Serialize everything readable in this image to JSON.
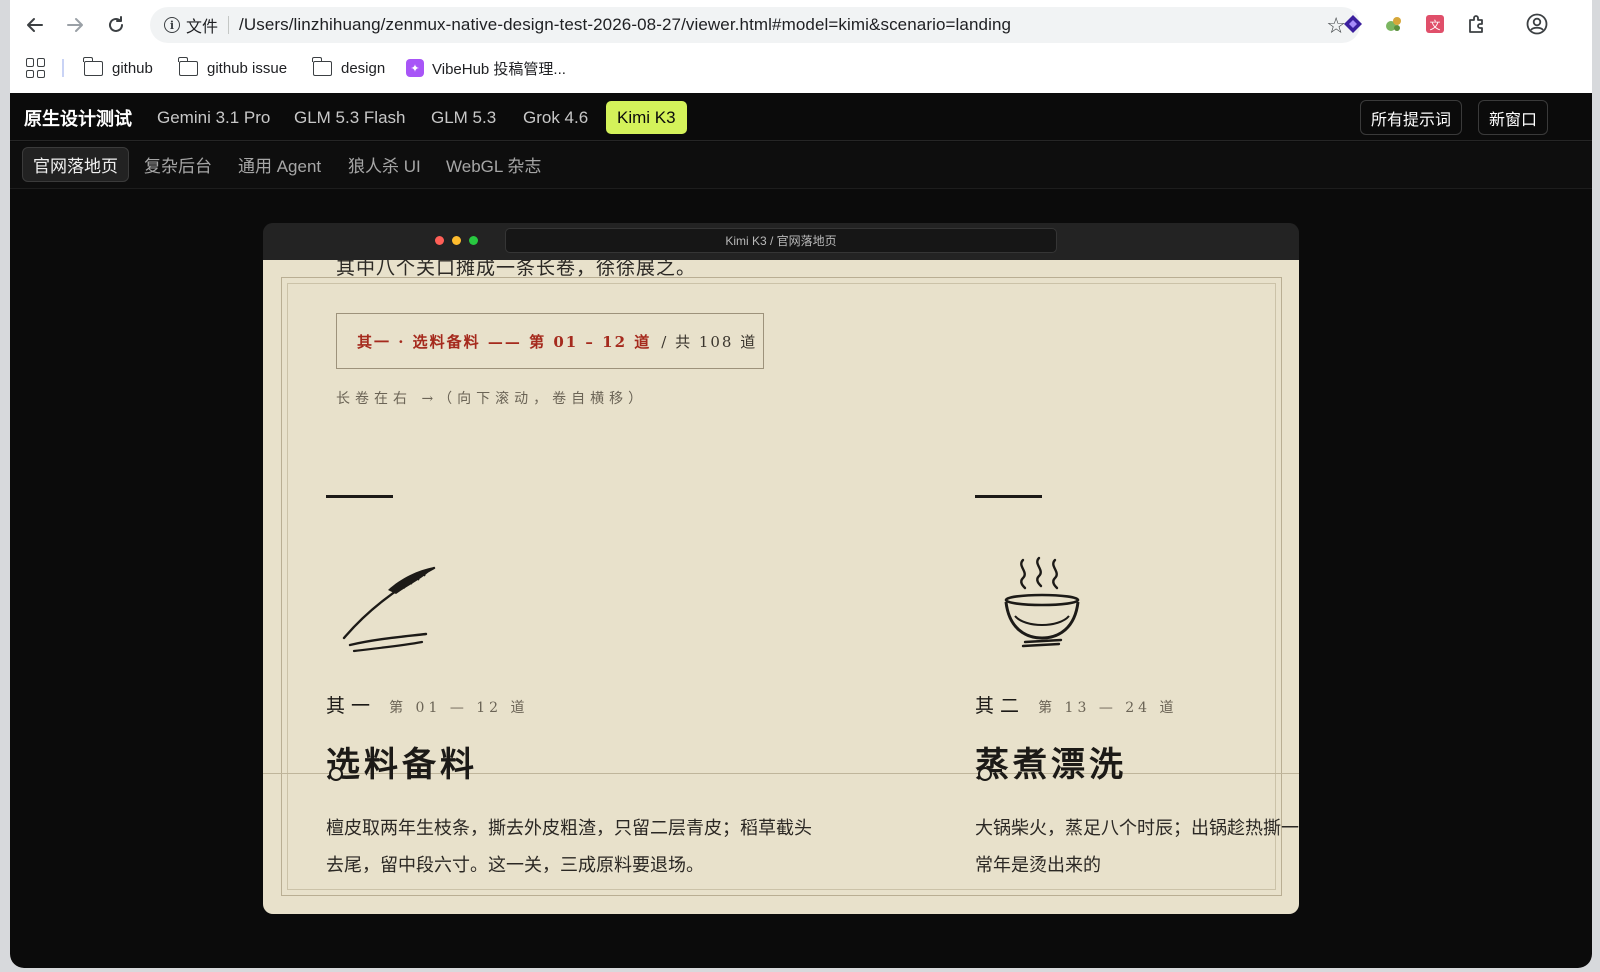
{
  "browser": {
    "url_scheme": "文件",
    "url": "/Users/linzhihuang/zenmux-native-design-test-2026-08-27/viewer.html#model=kimi&scenario=landing",
    "bookmarks": [
      "github",
      "github issue",
      "design",
      "VibeHub 投稿管理..."
    ]
  },
  "app": {
    "brand": "原生设计测试",
    "models": [
      "Gemini 3.1 Pro",
      "GLM 5.3 Flash",
      "GLM 5.3",
      "Grok 4.6",
      "Kimi K3"
    ],
    "active_model": "Kimi K3",
    "buttons": {
      "all_prompts": "所有提示词",
      "new_window": "新窗口"
    },
    "scenarios": [
      "官网落地页",
      "复杂后台",
      "通用 Agent",
      "狼人杀 UI",
      "WebGL 杂志"
    ],
    "active_scenario": "官网落地页",
    "accent_color": "#d4f25a"
  },
  "preview": {
    "window_title": "Kimi K3 / 官网落地页",
    "scroll_text": "其中八个关口摊成一条长卷，徐徐展之。",
    "chapter": {
      "red": "其一 · 选料备料 —— 第 01 – 12 道",
      "dark": "/ 共 108 道"
    },
    "hint": "长卷在右 →（向下滚动，卷自横移）",
    "sections": [
      {
        "icon": "brush-icon",
        "kicker_main": "其一",
        "kicker_sub": "第 01 — 12 道",
        "title": "选料备料",
        "body": "檀皮取两年生枝条，撕去外皮粗渣，只留二层青皮；稻草截头去尾，留中段六寸。这一关，三成原料要退场。"
      },
      {
        "icon": "steaming-bowl-icon",
        "kicker_main": "其二",
        "kicker_sub": "第 13 — 24 道",
        "title": "蒸煮漂洗",
        "body": "大锅柴火，蒸足八个时辰；出锅趁热撕一剔除。师傅的手背，常年是烫出来的"
      }
    ]
  }
}
